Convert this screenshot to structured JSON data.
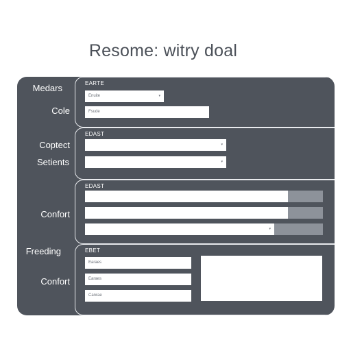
{
  "form": {
    "title": "Resome: witry doal"
  },
  "labels": {
    "medars": "Medars",
    "cole": "Cole",
    "coptect": "Coptect",
    "setients": "Setients",
    "confort_1": "Confort",
    "freeding": "Freeding",
    "confort_2": "Confort"
  },
  "sections": [
    {
      "tag": "EARTE",
      "fields": [
        {
          "text": "Enuite",
          "type": "dropdown",
          "arrow": "▾"
        },
        {
          "text": "Fsude",
          "type": "text"
        }
      ]
    },
    {
      "tag": "EDAST",
      "fields": [
        {
          "text": "",
          "type": "dropdown",
          "arrow": "▾"
        },
        {
          "text": "",
          "type": "dropdown",
          "arrow": "▾"
        }
      ]
    },
    {
      "tag": "EDAST",
      "fields": [
        {
          "text": "",
          "type": "text-with-button"
        },
        {
          "text": "",
          "type": "text-with-button"
        },
        {
          "text": "",
          "type": "dropdown-with-button",
          "arrow": "▾"
        }
      ]
    },
    {
      "tag": "ЕВЕТ",
      "fields": [
        {
          "text": "Earaes",
          "type": "text"
        },
        {
          "text": "Earaes",
          "type": "text"
        },
        {
          "text": "Canrae",
          "type": "text"
        }
      ]
    }
  ],
  "colors": {
    "panel": "#4f545c",
    "title": "#4b5058",
    "field": "#ffffff",
    "button": "#8d929a",
    "border": "#e9ebee"
  }
}
